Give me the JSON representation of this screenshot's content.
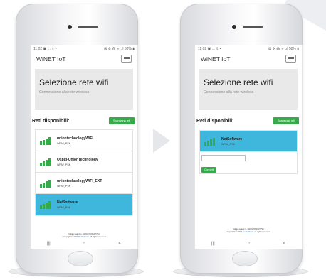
{
  "status_bar": {
    "time": "11:02",
    "icons": "▣ ... ⇩ •",
    "right": "⊠ ✲ ⁂ ᯤ .ıl 58% ▮"
  },
  "navbar": {
    "brand": "WiNET IoT"
  },
  "jumbotron": {
    "title": "Selezione rete wifi",
    "subtitle": "Connessione alla rete wireless"
  },
  "networks": {
    "title": "Reti disponibili:",
    "scan_label": "Scansiona reti",
    "items": [
      {
        "name": "uniontechnologyWiFi",
        "security": "WPA2_PSK"
      },
      {
        "name": "Ospiti-UnionTechnology",
        "security": "WPA2_PSK"
      },
      {
        "name": "uniontechnologyWiFi_EXT",
        "security": "WPA2_PSK"
      },
      {
        "name": "NetSoftware",
        "security": "WPA2_PSK"
      }
    ]
  },
  "selected": {
    "name": "NetSoftware",
    "security": "WPA2_PSK",
    "connect_label": "Connetti"
  },
  "footer": {
    "line1": "Italian patent n. 102017000107794",
    "line2_prefix": "Copyright © 2021",
    "line2_link": "NetSoftware",
    "line2_suffix": "all rights reserved"
  },
  "system_nav": {
    "recents": "|||",
    "home": "○",
    "back": "<"
  },
  "colors": {
    "accent_green": "#36a94a",
    "selected_blue": "#3fb6dc",
    "jumbotron_bg": "#e9e9e9"
  }
}
